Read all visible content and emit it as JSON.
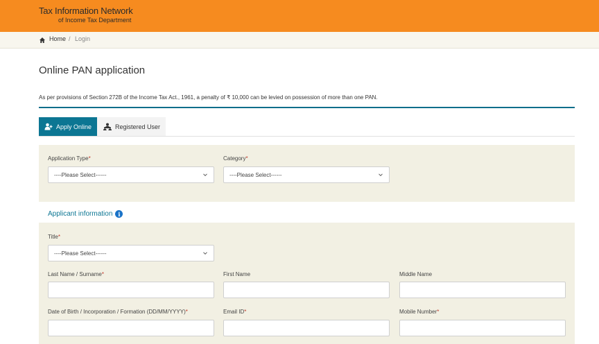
{
  "header": {
    "title": "Tax Information Network",
    "subtitle": "of Income Tax Department"
  },
  "breadcrumb": {
    "home": "Home",
    "separator": "/",
    "current": "Login"
  },
  "page": {
    "title": "Online PAN application",
    "notice": "As per provisions of Section 272B of the Income Tax Act., 1961, a penalty of ₹ 10,000 can be levied on possession of more than one PAN."
  },
  "tabs": {
    "apply_online": "Apply Online",
    "registered_user": "Registered User"
  },
  "form": {
    "application_type": {
      "label": "Application Type",
      "value": "----Please Select------"
    },
    "category": {
      "label": "Category",
      "value": "----Please Select------"
    },
    "required_marker": "*"
  },
  "applicant": {
    "heading": "Applicant information",
    "info_glyph": "i",
    "title": {
      "label": "Title",
      "value": "----Please Select------"
    },
    "last_name": {
      "label": "Last Name / Surname"
    },
    "first_name": {
      "label": "First Name"
    },
    "middle_name": {
      "label": "Middle Name"
    },
    "dob": {
      "label": "Date of Birth / Incorporation / Formation (DD/MM/YYYY)"
    },
    "email": {
      "label": "Email ID"
    },
    "mobile": {
      "label": "Mobile Number"
    }
  },
  "colors": {
    "header_bg": "#f68b1f",
    "accent": "#0c7693",
    "panel_bg": "#f2f0e3",
    "required": "#c0392b"
  }
}
